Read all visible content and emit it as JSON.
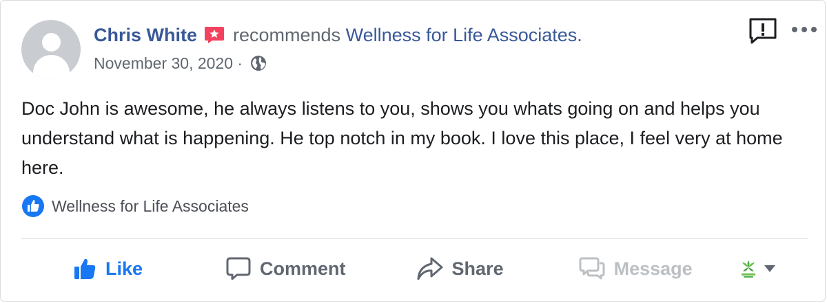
{
  "post": {
    "author": "Chris White",
    "verb": "recommends",
    "page_name": "Wellness for Life Associates.",
    "date": "November 30, 2020 ·",
    "audience_icon": "globe-icon",
    "review_text": "Doc John is awesome, he always listens to you, shows you whats going on and helps you understand what is happening. He top notch in my book. I love this place, I feel very at home here.",
    "tagged_page": "Wellness for Life Associates"
  },
  "actions": {
    "like": "Like",
    "comment": "Comment",
    "share": "Share",
    "message": "Message"
  },
  "colors": {
    "link_blue": "#385898",
    "like_blue": "#1877f2",
    "recommend_red": "#f3425f",
    "secondary_text": "#606770",
    "disabled_text": "#bcc0c4",
    "divider": "#dadde1"
  },
  "icons": [
    "recommend-star-icon",
    "globe-icon",
    "report-icon",
    "more-icon",
    "like-badge-icon",
    "like-thumb-icon",
    "comment-icon",
    "share-icon",
    "message-icon",
    "page-logo-icon",
    "caret-down-icon"
  ]
}
